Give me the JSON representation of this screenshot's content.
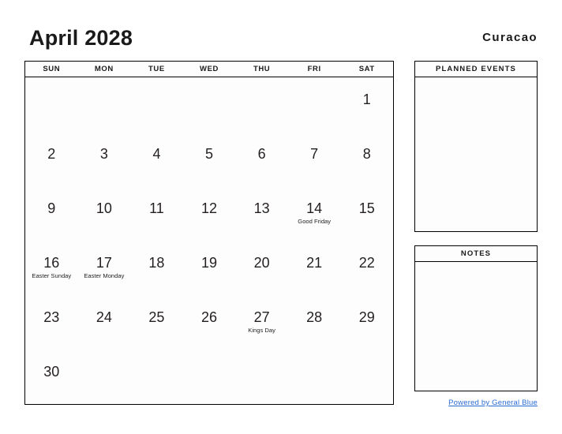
{
  "header": {
    "month_title": "April 2028",
    "country": "Curacao"
  },
  "calendar": {
    "weekdays": [
      "SUN",
      "MON",
      "TUE",
      "WED",
      "THU",
      "FRI",
      "SAT"
    ],
    "weeks": [
      [
        {
          "day": "",
          "event": ""
        },
        {
          "day": "",
          "event": ""
        },
        {
          "day": "",
          "event": ""
        },
        {
          "day": "",
          "event": ""
        },
        {
          "day": "",
          "event": ""
        },
        {
          "day": "",
          "event": ""
        },
        {
          "day": "1",
          "event": ""
        }
      ],
      [
        {
          "day": "2",
          "event": ""
        },
        {
          "day": "3",
          "event": ""
        },
        {
          "day": "4",
          "event": ""
        },
        {
          "day": "5",
          "event": ""
        },
        {
          "day": "6",
          "event": ""
        },
        {
          "day": "7",
          "event": ""
        },
        {
          "day": "8",
          "event": ""
        }
      ],
      [
        {
          "day": "9",
          "event": ""
        },
        {
          "day": "10",
          "event": ""
        },
        {
          "day": "11",
          "event": ""
        },
        {
          "day": "12",
          "event": ""
        },
        {
          "day": "13",
          "event": ""
        },
        {
          "day": "14",
          "event": "Good Friday"
        },
        {
          "day": "15",
          "event": ""
        }
      ],
      [
        {
          "day": "16",
          "event": "Easter Sunday"
        },
        {
          "day": "17",
          "event": "Easter Monday"
        },
        {
          "day": "18",
          "event": ""
        },
        {
          "day": "19",
          "event": ""
        },
        {
          "day": "20",
          "event": ""
        },
        {
          "day": "21",
          "event": ""
        },
        {
          "day": "22",
          "event": ""
        }
      ],
      [
        {
          "day": "23",
          "event": ""
        },
        {
          "day": "24",
          "event": ""
        },
        {
          "day": "25",
          "event": ""
        },
        {
          "day": "26",
          "event": ""
        },
        {
          "day": "27",
          "event": "Kings Day"
        },
        {
          "day": "28",
          "event": ""
        },
        {
          "day": "29",
          "event": ""
        }
      ],
      [
        {
          "day": "30",
          "event": ""
        },
        {
          "day": "",
          "event": ""
        },
        {
          "day": "",
          "event": ""
        },
        {
          "day": "",
          "event": ""
        },
        {
          "day": "",
          "event": ""
        },
        {
          "day": "",
          "event": ""
        },
        {
          "day": "",
          "event": ""
        }
      ]
    ]
  },
  "panels": {
    "planned_events_title": "PLANNED EVENTS",
    "notes_title": "NOTES"
  },
  "footer": {
    "link_text": "Powered by General Blue",
    "link_color": "#2b6cd4"
  }
}
